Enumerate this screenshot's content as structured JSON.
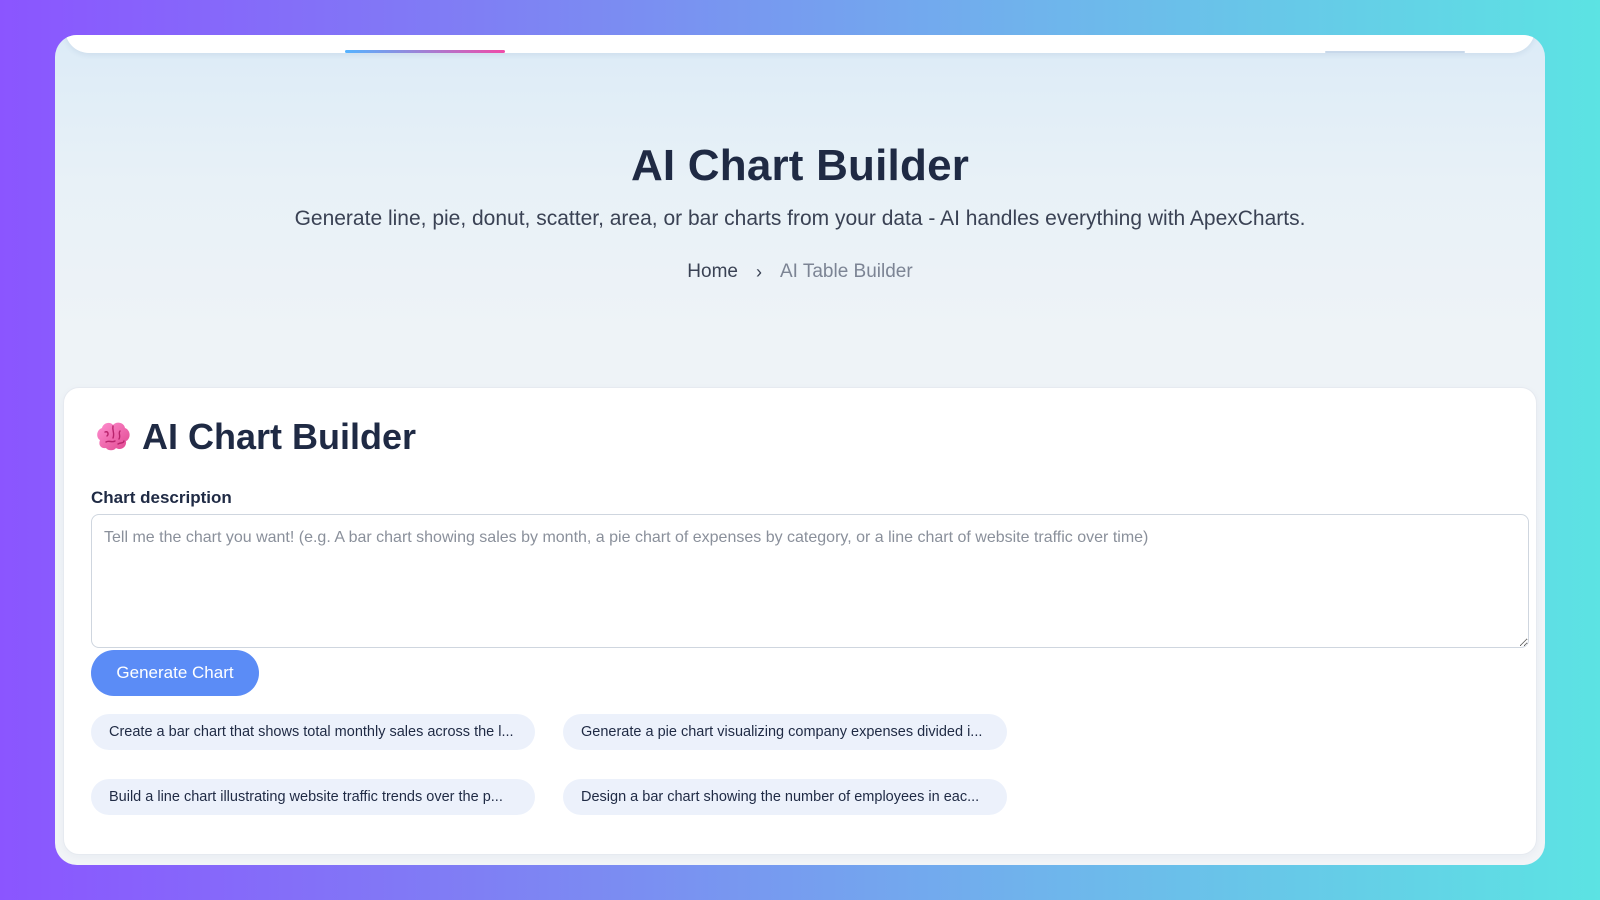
{
  "hero": {
    "title": "AI Chart Builder",
    "subtitle": "Generate line, pie, donut, scatter, area, or bar charts from your data - AI handles everything with ApexCharts.",
    "breadcrumb": {
      "home": "Home",
      "separator": "›",
      "current": "AI Table Builder"
    }
  },
  "card": {
    "icon": "brain-icon",
    "title": "AI Chart Builder",
    "field_label": "Chart description",
    "textarea_placeholder": "Tell me the chart you want! (e.g. A bar chart showing sales by month, a pie chart of expenses by category, or a line chart of website traffic over time)",
    "generate_label": "Generate Chart",
    "suggestions": [
      "Create a bar chart that shows total monthly sales across the l...",
      "Generate a pie chart visualizing company expenses divided i...",
      "Build a line chart illustrating website traffic trends over the p...",
      "Design a bar chart showing the number of employees in eac..."
    ]
  },
  "colors": {
    "accent": "#5b8cf6",
    "heading": "#1f2a44",
    "chip_bg": "#ecf1fb"
  }
}
